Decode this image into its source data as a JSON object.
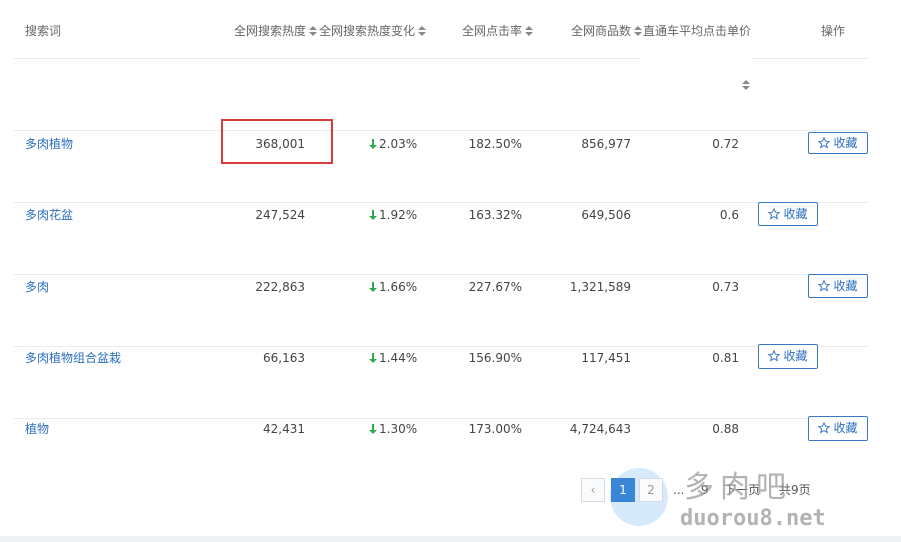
{
  "headers": {
    "keyword": "搜索词",
    "heat": "全网搜索热度",
    "heat_change": "全网搜索热度变化",
    "ctr": "全网点击率",
    "goods": "全网商品数",
    "avg_price": "直通车平均点击单价",
    "action": "操作"
  },
  "rows": [
    {
      "keyword": "多肉植物",
      "heat": "368,001",
      "change": "2.03%",
      "ctr": "182.50%",
      "goods": "856,977",
      "price": "0.72",
      "fav_label": "收藏"
    },
    {
      "keyword": "多肉花盆",
      "heat": "247,524",
      "change": "1.92%",
      "ctr": "163.32%",
      "goods": "649,506",
      "price": "0.6",
      "fav_label": "收藏"
    },
    {
      "keyword": "多肉",
      "heat": "222,863",
      "change": "1.66%",
      "ctr": "227.67%",
      "goods": "1,321,589",
      "price": "0.73",
      "fav_label": "收藏"
    },
    {
      "keyword": "多肉植物组合盆栽",
      "heat": "66,163",
      "change": "1.44%",
      "ctr": "156.90%",
      "goods": "117,451",
      "price": "0.81",
      "fav_label": "收藏"
    },
    {
      "keyword": "植物",
      "heat": "42,431",
      "change": "1.30%",
      "ctr": "173.00%",
      "goods": "4,724,643",
      "price": "0.88",
      "fav_label": "收藏"
    }
  ],
  "pagination": {
    "prev": "‹",
    "page1": "1",
    "page2": "2",
    "ellipsis": "...",
    "page9": "9",
    "next": "下一页",
    "total": "共9页"
  },
  "watermark": {
    "text_cn": "多肉吧",
    "text_en": "duorou8.net"
  },
  "colors": {
    "link": "#2b6fbf",
    "down_arrow": "#2fa84f",
    "highlight": "#d93a3a",
    "pager_active": "#3a86d6"
  }
}
